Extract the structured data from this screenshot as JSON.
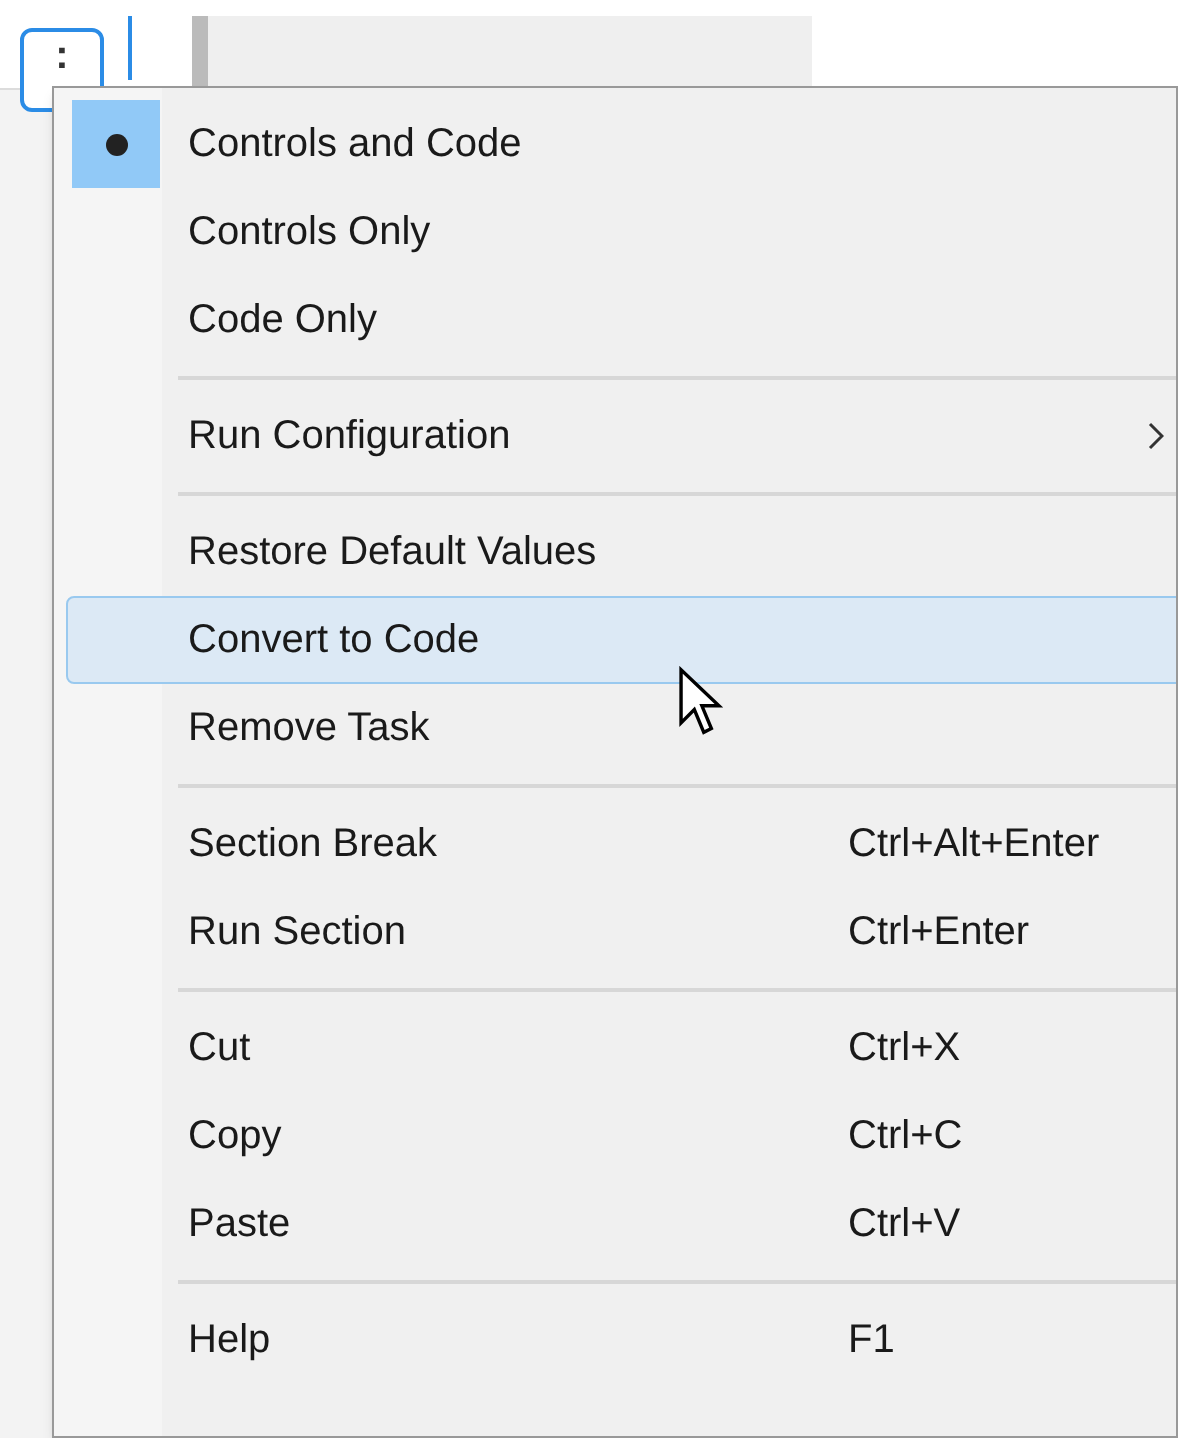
{
  "toolbar": {
    "more_button": ":"
  },
  "menu": {
    "groups": [
      {
        "items": [
          {
            "label": "Controls and Code",
            "selected": true,
            "highlighted": false
          },
          {
            "label": "Controls Only",
            "selected": false,
            "highlighted": false
          },
          {
            "label": "Code Only",
            "selected": false,
            "highlighted": false
          }
        ]
      },
      {
        "items": [
          {
            "label": "Run Configuration",
            "has_submenu": true,
            "highlighted": false
          }
        ]
      },
      {
        "items": [
          {
            "label": "Restore Default Values",
            "highlighted": false
          },
          {
            "label": "Convert to Code",
            "highlighted": true
          },
          {
            "label": "Remove Task",
            "highlighted": false
          }
        ]
      },
      {
        "items": [
          {
            "label": "Section Break",
            "shortcut": "Ctrl+Alt+Enter",
            "highlighted": false
          },
          {
            "label": "Run Section",
            "shortcut": "Ctrl+Enter",
            "highlighted": false
          }
        ]
      },
      {
        "items": [
          {
            "label": "Cut",
            "shortcut": "Ctrl+X",
            "highlighted": false
          },
          {
            "label": "Copy",
            "shortcut": "Ctrl+C",
            "highlighted": false
          },
          {
            "label": "Paste",
            "shortcut": "Ctrl+V",
            "highlighted": false
          }
        ]
      },
      {
        "items": [
          {
            "label": "Help",
            "shortcut": "F1",
            "highlighted": false
          }
        ]
      }
    ]
  }
}
